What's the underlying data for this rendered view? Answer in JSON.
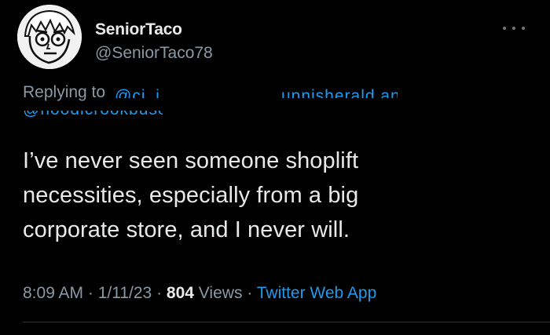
{
  "author": {
    "display_name": "SeniorTaco",
    "handle": "@SeniorTaco78",
    "avatar_icon": "cartoon-face-avatar"
  },
  "reply": {
    "prefix": "Replying to ",
    "mentions_line1": "@ci_j    ___  ___  ___ _unnisherald and",
    "mentions_line2": "@hoodlcrookbusor"
  },
  "tweet": {
    "text_lines": [
      "I’ve never seen someone shoplift",
      "necessities, especially from a big",
      "corporate store, and I never will."
    ]
  },
  "meta": {
    "time": "8:09 AM",
    "separator": " · ",
    "date": "1/11/23",
    "views_count": "804",
    "views_label": " Views",
    "source": "Twitter Web App"
  },
  "colors": {
    "background": "#000000",
    "text": "#e7e9ea",
    "secondary": "#8b98a5",
    "link": "#1d9bf0"
  }
}
